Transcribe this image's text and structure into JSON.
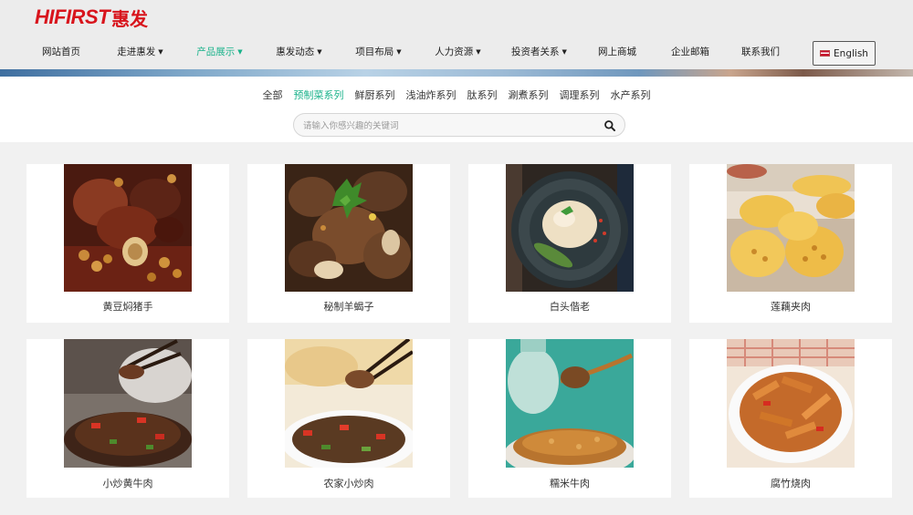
{
  "brand": {
    "logo_en": "HIFIRST",
    "logo_cn": "惠发",
    "color": "#d8141c"
  },
  "nav": {
    "items": [
      {
        "label": "网站首页",
        "dropdown": false,
        "active": false
      },
      {
        "label": "走进惠发",
        "dropdown": true,
        "active": false
      },
      {
        "label": "产品展示",
        "dropdown": true,
        "active": true
      },
      {
        "label": "惠发动态",
        "dropdown": true,
        "active": false
      },
      {
        "label": "项目布局",
        "dropdown": true,
        "active": false
      },
      {
        "label": "人力资源",
        "dropdown": true,
        "active": false
      },
      {
        "label": "投资者关系",
        "dropdown": true,
        "active": false
      },
      {
        "label": "网上商城",
        "dropdown": false,
        "active": false
      },
      {
        "label": "企业邮箱",
        "dropdown": false,
        "active": false
      },
      {
        "label": "联系我们",
        "dropdown": false,
        "active": false
      }
    ],
    "language_button": "English",
    "accent_color": "#19b28a"
  },
  "filter": {
    "categories": [
      "全部",
      "预制菜系列",
      "鲜厨系列",
      "浅油炸系列",
      "肽系列",
      "涮煮系列",
      "调理系列",
      "水产系列"
    ],
    "active_category": "预制菜系列",
    "search_placeholder": "请输入你感兴趣的关键词",
    "search_value": ""
  },
  "products": [
    {
      "name": "黄豆焖猪手",
      "icon": "braised-pork-trotter-photo"
    },
    {
      "name": "秘制羊蝎子",
      "icon": "lamb-spine-photo"
    },
    {
      "name": "白头偕老",
      "icon": "white-dumpling-bowl-photo"
    },
    {
      "name": "莲藕夹肉",
      "icon": "fried-lotus-root-photo"
    },
    {
      "name": "小炒黄牛肉",
      "icon": "stir-fried-beef-photo"
    },
    {
      "name": "农家小炒肉",
      "icon": "farmhouse-pork-photo"
    },
    {
      "name": "糯米牛肉",
      "icon": "glutinous-rice-beef-photo"
    },
    {
      "name": "腐竹烧肉",
      "icon": "tofu-skin-pork-photo"
    }
  ]
}
